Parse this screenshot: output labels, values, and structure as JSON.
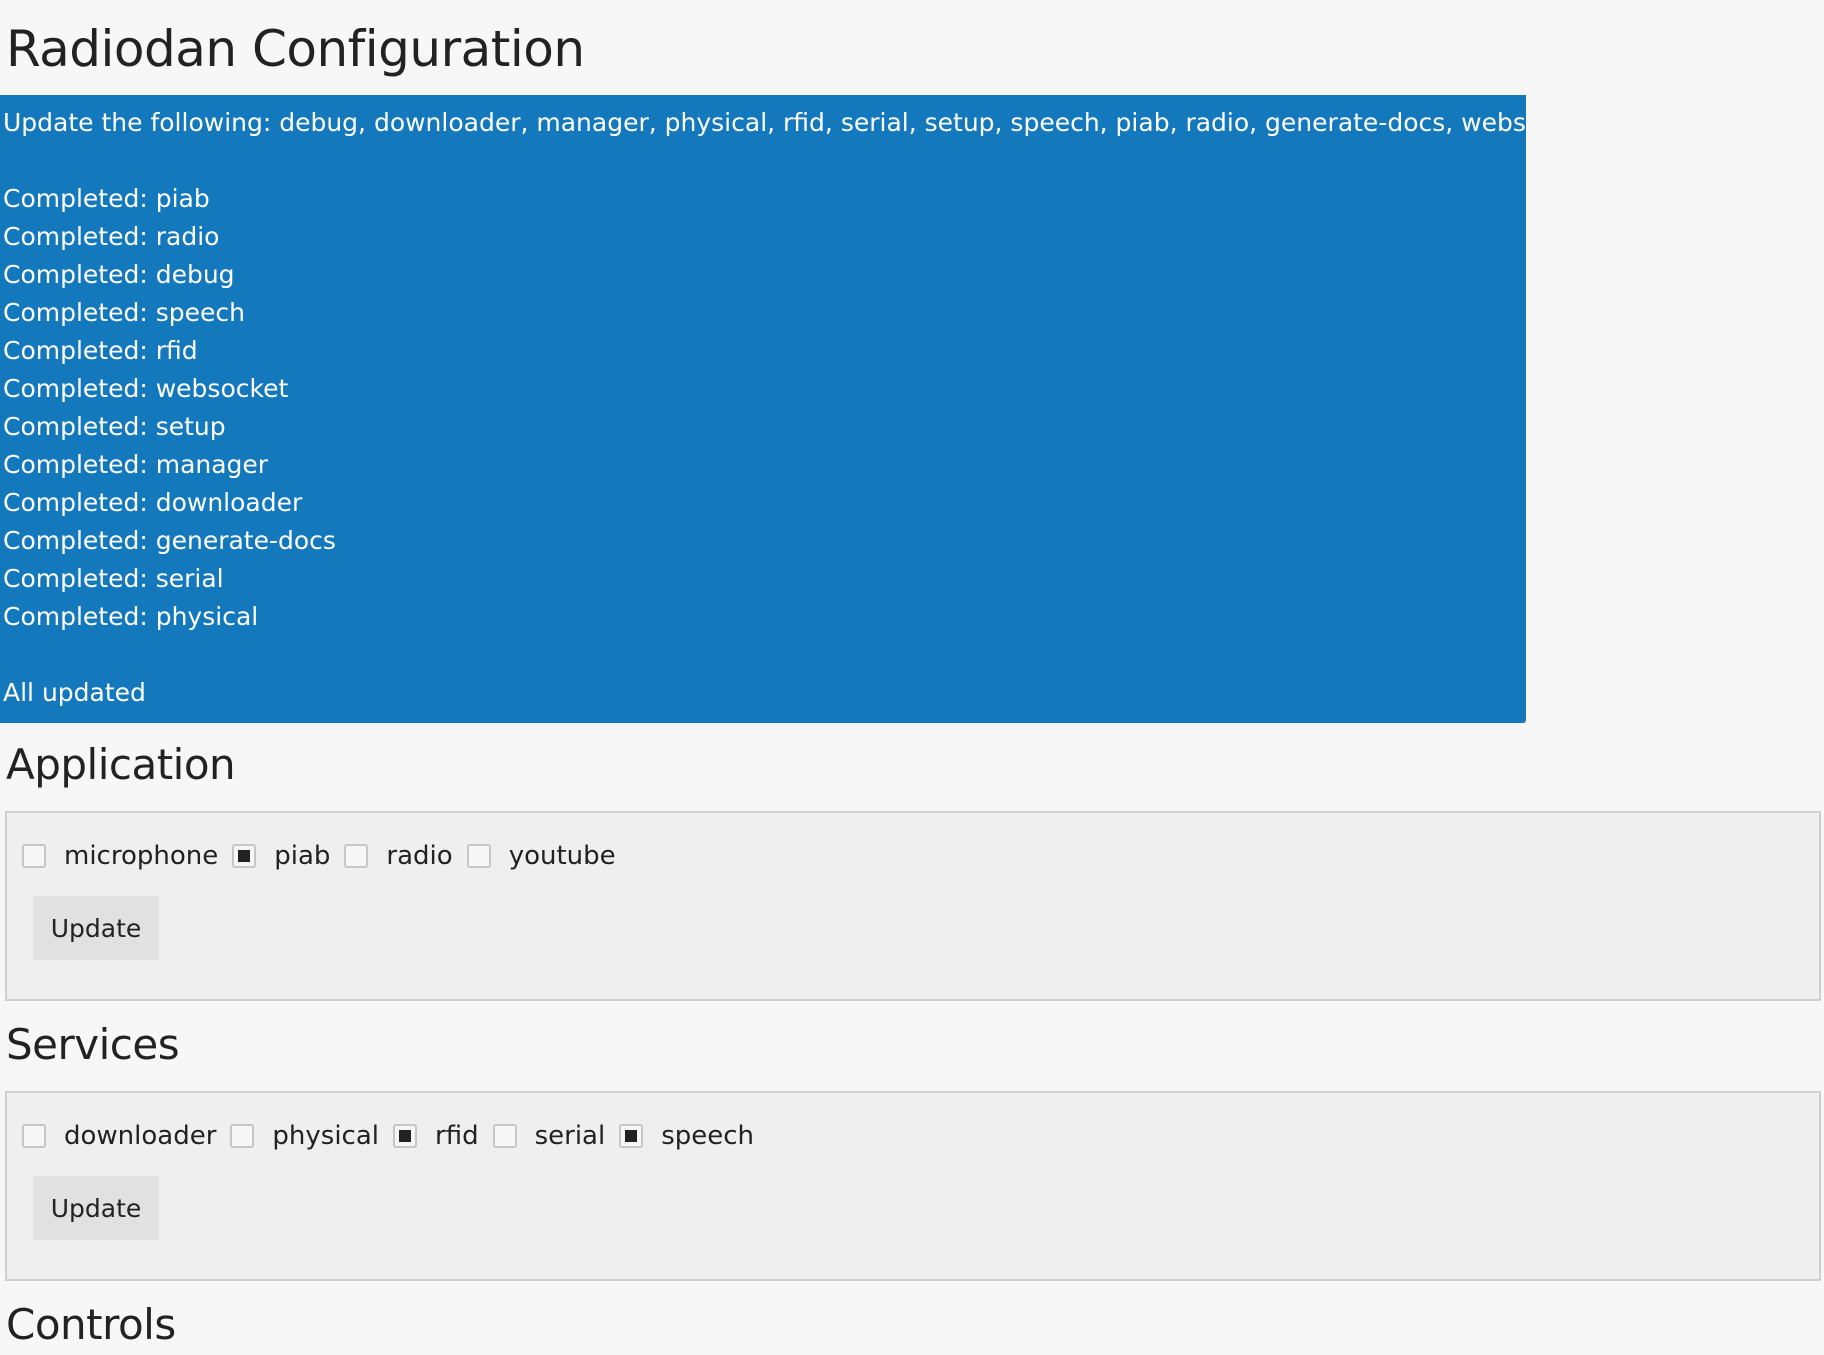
{
  "page": {
    "title": "Radiodan Configuration"
  },
  "status": {
    "update_line": "Update the following: debug, downloader, manager, physical, rfid, serial, setup, speech, piab, radio, generate-docs, websocket",
    "completed": [
      "Completed: piab",
      "Completed: radio",
      "Completed: debug",
      "Completed: speech",
      "Completed: rfid",
      "Completed: websocket",
      "Completed: setup",
      "Completed: manager",
      "Completed: downloader",
      "Completed: generate-docs",
      "Completed: serial",
      "Completed: physical"
    ],
    "final_line": "All updated",
    "background_color": "#1378bc"
  },
  "application": {
    "heading": "Application",
    "options": [
      {
        "label": "microphone",
        "checked": false
      },
      {
        "label": "piab",
        "checked": true
      },
      {
        "label": "radio",
        "checked": false
      },
      {
        "label": "youtube",
        "checked": false
      }
    ],
    "update_label": "Update"
  },
  "services": {
    "heading": "Services",
    "options": [
      {
        "label": "downloader",
        "checked": false
      },
      {
        "label": "physical",
        "checked": false
      },
      {
        "label": "rfid",
        "checked": true
      },
      {
        "label": "serial",
        "checked": false
      },
      {
        "label": "speech",
        "checked": true
      }
    ],
    "update_label": "Update"
  },
  "controls": {
    "heading": "Controls"
  }
}
